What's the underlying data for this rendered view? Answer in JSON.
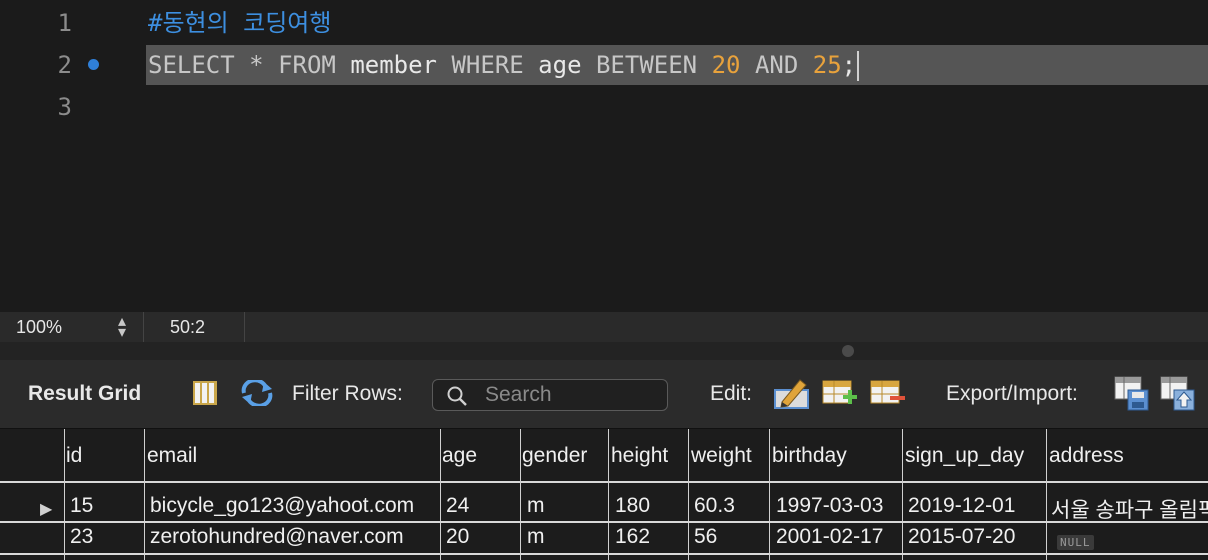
{
  "editor": {
    "lines": [
      {
        "num": "1",
        "comment": "#동현의 코딩여행"
      },
      {
        "num": "2",
        "tokens": {
          "select": "SELECT",
          "star": "*",
          "from": "FROM",
          "table": "member",
          "where": "WHERE",
          "col": "age",
          "between": "BETWEEN",
          "n1": "20",
          "and": "AND",
          "n2": "25",
          "semi": ";"
        }
      },
      {
        "num": "3"
      }
    ]
  },
  "status": {
    "zoom": "100%",
    "position": "50:2"
  },
  "toolbar": {
    "result_grid": "Result Grid",
    "filter_rows": "Filter Rows:",
    "search_placeholder": "Search",
    "edit": "Edit:",
    "export_import": "Export/Import:"
  },
  "grid": {
    "columns": [
      "id",
      "email",
      "age",
      "gender",
      "height",
      "weight",
      "birthday",
      "sign_up_day",
      "address"
    ],
    "rows": [
      {
        "id": "15",
        "email": "bicycle_go123@yahoot.com",
        "age": "24",
        "gender": "m",
        "height": "180",
        "weight": "60.3",
        "birthday": "1997-03-03",
        "sign_up_day": "2019-12-01",
        "address": "서울 송파구 올림픽"
      },
      {
        "id": "23",
        "email": "zerotohundred@naver.com",
        "age": "20",
        "gender": "m",
        "height": "162",
        "weight": "56",
        "birthday": "2001-02-17",
        "sign_up_day": "2015-07-20",
        "address": "NULL"
      }
    ]
  },
  "colors": {
    "accent": "#2f7fd8",
    "number": "#e8a23c",
    "comment": "#3d8fe0"
  },
  "icons": [
    "search-icon",
    "toggle-columns-icon",
    "refresh-icon",
    "edit-pencil-icon",
    "add-row-icon",
    "delete-row-icon",
    "export-icon",
    "import-icon"
  ]
}
